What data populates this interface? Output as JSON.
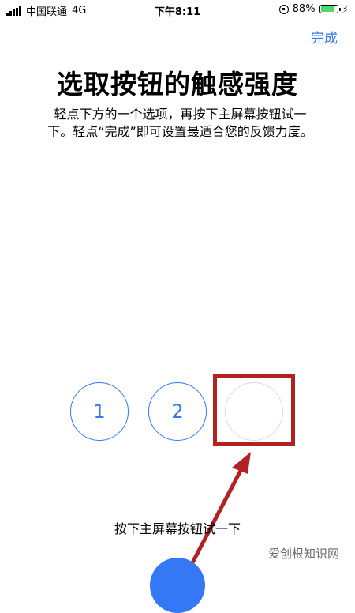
{
  "status_bar": {
    "carrier": "中国联通",
    "network": "4G",
    "time": "下午8:11",
    "battery_percent": "88%",
    "battery_level": 0.88,
    "signal_icon": "signal-bars-icon",
    "rotation_lock_icon": "rotation-lock-icon",
    "charging_icon": "bolt-icon"
  },
  "nav": {
    "done_label": "完成"
  },
  "title": "选取按钮的触感强度",
  "description": "轻点下方的一个选项，再按下主屏幕按钮试一下。轻点“完成”即可设置最适合您的反馈力度。",
  "options": [
    {
      "label": "1"
    },
    {
      "label": "2"
    },
    {
      "label": ""
    }
  ],
  "hint": "按下主屏幕按钮试一下",
  "watermark": "爱创根知识网",
  "colors": {
    "accent": "#3478f6",
    "annotation": "#b22222",
    "battery": "#4cd964"
  }
}
